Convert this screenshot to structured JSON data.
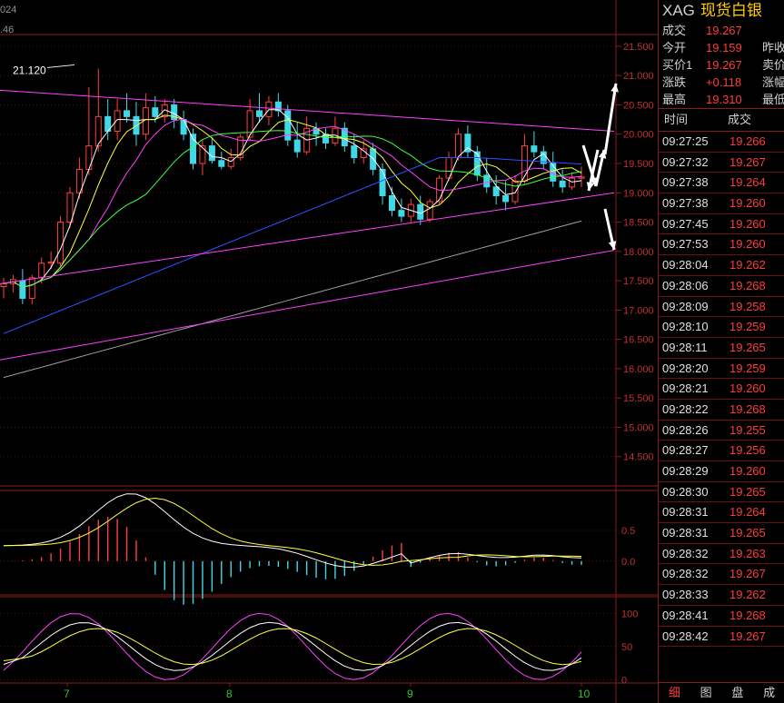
{
  "header": {
    "line1": "024",
    "line2": ".46"
  },
  "symbol": {
    "code": "XAG",
    "name": "现货白银"
  },
  "quote": [
    {
      "label": "成交",
      "value": "19.267",
      "label2": ""
    },
    {
      "label": "今开",
      "value": "19.159",
      "label2": "昨收"
    },
    {
      "label": "买价1",
      "value": "19.267",
      "label2": "卖价"
    },
    {
      "label": "涨跌",
      "value": "+0.118",
      "label2": "涨幅"
    },
    {
      "label": "最高",
      "value": "19.310",
      "label2": "最低"
    }
  ],
  "ticks_header": {
    "time": "时间",
    "price": "成交"
  },
  "ticks": [
    [
      "09:27:25",
      "19.266"
    ],
    [
      "09:27:32",
      "19.267"
    ],
    [
      "09:27:38",
      "19.264"
    ],
    [
      "09:27:38",
      "19.260"
    ],
    [
      "09:27:45",
      "19.260"
    ],
    [
      "09:27:53",
      "19.260"
    ],
    [
      "09:28:04",
      "19.262"
    ],
    [
      "09:28:06",
      "19.268"
    ],
    [
      "09:28:09",
      "19.258"
    ],
    [
      "09:28:10",
      "19.259"
    ],
    [
      "09:28:11",
      "19.265"
    ],
    [
      "09:28:20",
      "19.259"
    ],
    [
      "09:28:21",
      "19.260"
    ],
    [
      "09:28:22",
      "19.268"
    ],
    [
      "09:28:26",
      "19.255"
    ],
    [
      "09:28:27",
      "19.256"
    ],
    [
      "09:28:29",
      "19.260"
    ],
    [
      "09:28:30",
      "19.265"
    ],
    [
      "09:28:31",
      "19.264"
    ],
    [
      "09:28:31",
      "19.265"
    ],
    [
      "09:28:32",
      "19.263"
    ],
    [
      "09:28:32",
      "19.267"
    ],
    [
      "09:28:33",
      "19.262"
    ],
    [
      "09:28:41",
      "19.268"
    ],
    [
      "09:28:42",
      "19.267"
    ]
  ],
  "tabs": [
    "细",
    "图",
    "盘",
    "成"
  ],
  "colors": {
    "accent": "#ff3b3b",
    "grid": "#8b1a1a",
    "up": "#ff4040",
    "down": "#40d8e8"
  },
  "chart_data": [
    {
      "type": "candlestick",
      "title": "",
      "y_ticks": [
        "21.500",
        "21.000",
        "20.500",
        "20.000",
        "19.500",
        "19.000",
        "18.500",
        "18.000",
        "17.500",
        "17.000",
        "16.500",
        "16.000",
        "15.500",
        "15.000",
        "14.500"
      ],
      "x_ticks": [
        "7",
        "8",
        "9",
        "10"
      ],
      "annotation": "21.120",
      "ylim": [
        14.0,
        21.7
      ],
      "ohlc": [
        [
          17.4,
          17.55,
          17.2,
          17.45
        ],
        [
          17.45,
          17.6,
          17.3,
          17.52
        ],
        [
          17.5,
          17.7,
          17.1,
          17.2
        ],
        [
          17.2,
          17.6,
          17.1,
          17.55
        ],
        [
          17.55,
          17.9,
          17.45,
          17.8
        ],
        [
          17.8,
          18.0,
          17.7,
          17.82
        ],
        [
          17.8,
          18.6,
          17.75,
          18.5
        ],
        [
          18.5,
          19.1,
          18.4,
          19.0
        ],
        [
          19.0,
          19.6,
          18.9,
          19.4
        ],
        [
          19.4,
          20.8,
          19.3,
          19.8
        ],
        [
          19.8,
          21.12,
          19.7,
          20.3
        ],
        [
          20.3,
          20.6,
          19.9,
          20.05
        ],
        [
          20.05,
          20.6,
          19.9,
          20.4
        ],
        [
          20.4,
          20.7,
          20.2,
          20.3
        ],
        [
          20.3,
          20.55,
          19.8,
          20.0
        ],
        [
          20.0,
          20.7,
          19.9,
          20.45
        ],
        [
          20.45,
          20.65,
          20.2,
          20.3
        ],
        [
          20.3,
          20.6,
          20.2,
          20.5
        ],
        [
          20.5,
          20.6,
          20.1,
          20.25
        ],
        [
          20.25,
          20.4,
          19.9,
          20.0
        ],
        [
          20.0,
          20.1,
          19.4,
          19.5
        ],
        [
          19.5,
          19.9,
          19.3,
          19.8
        ],
        [
          19.8,
          19.95,
          19.5,
          19.55
        ],
        [
          19.55,
          19.7,
          19.4,
          19.45
        ],
        [
          19.45,
          19.75,
          19.4,
          19.6
        ],
        [
          19.6,
          20.0,
          19.55,
          19.95
        ],
        [
          19.95,
          20.6,
          19.9,
          20.4
        ],
        [
          20.4,
          20.7,
          20.2,
          20.3
        ],
        [
          20.3,
          20.65,
          20.15,
          20.55
        ],
        [
          20.55,
          20.7,
          20.3,
          20.4
        ],
        [
          20.4,
          20.5,
          19.8,
          19.9
        ],
        [
          19.9,
          20.2,
          19.6,
          19.7
        ],
        [
          19.7,
          20.3,
          19.65,
          20.1
        ],
        [
          20.1,
          20.2,
          19.8,
          20.0
        ],
        [
          20.0,
          20.1,
          19.75,
          19.85
        ],
        [
          19.85,
          20.3,
          19.8,
          20.1
        ],
        [
          20.1,
          20.2,
          19.7,
          19.8
        ],
        [
          19.8,
          20.0,
          19.5,
          19.6
        ],
        [
          19.6,
          19.9,
          19.5,
          19.75
        ],
        [
          19.75,
          19.85,
          19.3,
          19.4
        ],
        [
          19.4,
          19.5,
          18.8,
          18.95
        ],
        [
          18.95,
          19.1,
          18.6,
          18.7
        ],
        [
          18.7,
          18.9,
          18.5,
          18.6
        ],
        [
          18.6,
          18.9,
          18.5,
          18.8
        ],
        [
          18.8,
          18.95,
          18.45,
          18.55
        ],
        [
          18.55,
          18.9,
          18.5,
          18.85
        ],
        [
          18.85,
          19.3,
          18.8,
          19.25
        ],
        [
          19.25,
          19.7,
          19.2,
          19.6
        ],
        [
          19.6,
          20.1,
          19.55,
          20.0
        ],
        [
          20.0,
          20.15,
          19.6,
          19.7
        ],
        [
          19.7,
          19.8,
          19.2,
          19.3
        ],
        [
          19.3,
          19.6,
          19.0,
          19.1
        ],
        [
          19.1,
          19.3,
          18.8,
          18.95
        ],
        [
          18.95,
          19.2,
          18.7,
          18.85
        ],
        [
          18.85,
          19.3,
          18.8,
          19.2
        ],
        [
          19.2,
          20.0,
          19.15,
          19.8
        ],
        [
          19.8,
          20.05,
          19.6,
          19.7
        ],
        [
          19.7,
          19.8,
          19.4,
          19.5
        ],
        [
          19.5,
          19.7,
          19.1,
          19.2
        ],
        [
          19.2,
          19.4,
          19.0,
          19.1
        ],
        [
          19.1,
          19.35,
          19.05,
          19.25
        ],
        [
          19.25,
          19.45,
          19.1,
          19.27
        ]
      ]
    },
    {
      "type": "line",
      "title": "",
      "y_ticks": [
        "0.5",
        "0.0"
      ],
      "ylim": [
        -0.55,
        1.15
      ]
    },
    {
      "type": "line",
      "title": "",
      "y_ticks": [
        "100",
        "50",
        "0"
      ],
      "ylim": [
        -5,
        125
      ]
    }
  ]
}
